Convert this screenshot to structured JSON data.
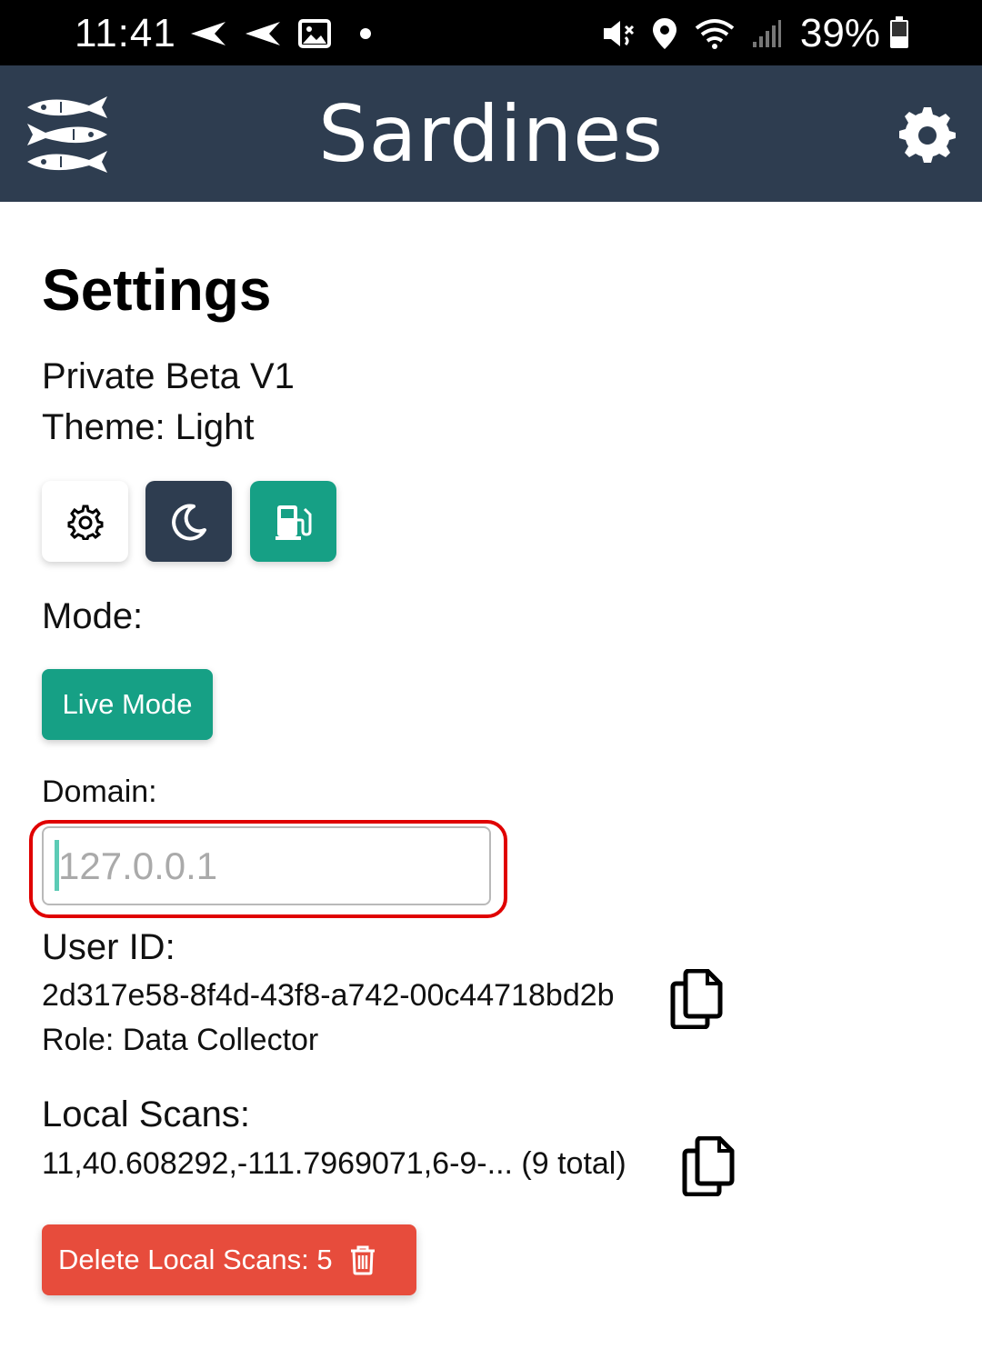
{
  "status_bar": {
    "time": "11:41",
    "battery": "39%"
  },
  "app_bar": {
    "title": "Sardines",
    "logo_icon": "sardines-logo-icon",
    "settings_icon": "gear-icon"
  },
  "settings": {
    "title": "Settings",
    "version": "Private Beta V1",
    "theme": "Theme: Light",
    "theme_buttons": [
      {
        "icon": "gear-icon"
      },
      {
        "icon": "moon-icon"
      },
      {
        "icon": "gas-pump-icon"
      }
    ],
    "mode_label": "Mode:",
    "mode_button": "Live Mode",
    "domain_label": "Domain:",
    "domain_placeholder": "127.0.0.1",
    "user_id_label": "User ID:",
    "user_id": "2d317e58-8f4d-43f8-a742-00c44718bd2b",
    "role": "Role: Data Collector",
    "local_scans_label": "Local Scans:",
    "local_scans_value": "11,40.608292,-111.7969071,6-9-... (9 total)",
    "delete_button": "Delete Local Scans: 5"
  },
  "colors": {
    "header": "#2e3d50",
    "accent": "#16a085",
    "danger": "#e74c3c",
    "highlight": "#e00000"
  }
}
